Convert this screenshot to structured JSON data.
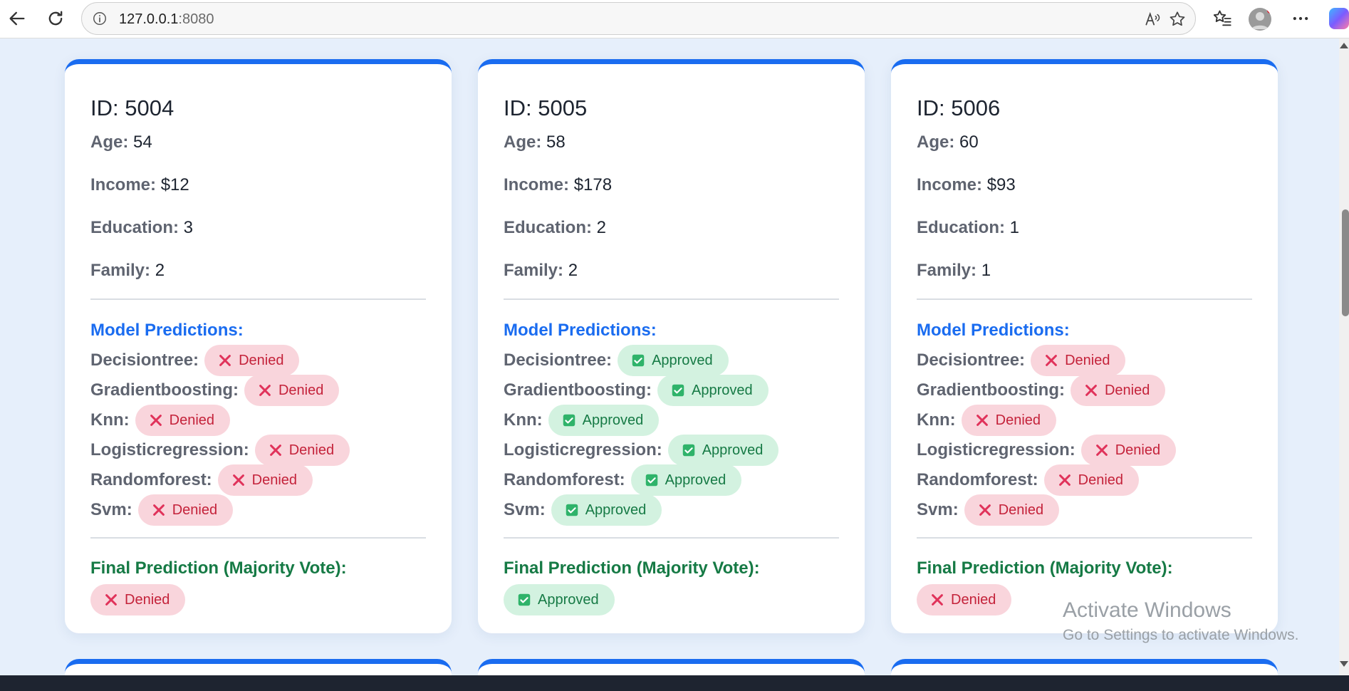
{
  "browser": {
    "url_host": "127.0.0.1",
    "url_port": ":8080"
  },
  "cards": [
    {
      "id": "ID: 5004",
      "age_label": "Age:",
      "age": "54",
      "income_label": "Income:",
      "income": "$12",
      "education_label": "Education:",
      "education": "3",
      "family_label": "Family:",
      "family": "2",
      "predictions_title": "Model Predictions:",
      "predictions": [
        {
          "model": "Decisiontree:",
          "result": "Denied",
          "status": "denied"
        },
        {
          "model": "Gradientboosting:",
          "result": "Denied",
          "status": "denied"
        },
        {
          "model": "Knn:",
          "result": "Denied",
          "status": "denied"
        },
        {
          "model": "Logisticregression:",
          "result": "Denied",
          "status": "denied"
        },
        {
          "model": "Randomforest:",
          "result": "Denied",
          "status": "denied"
        },
        {
          "model": "Svm:",
          "result": "Denied",
          "status": "denied"
        }
      ],
      "final_title": "Final Prediction (Majority Vote):",
      "final": "Denied",
      "final_status": "denied"
    },
    {
      "id": "ID: 5005",
      "age_label": "Age:",
      "age": "58",
      "income_label": "Income:",
      "income": "$178",
      "education_label": "Education:",
      "education": "2",
      "family_label": "Family:",
      "family": "2",
      "predictions_title": "Model Predictions:",
      "predictions": [
        {
          "model": "Decisiontree:",
          "result": "Approved",
          "status": "approved"
        },
        {
          "model": "Gradientboosting:",
          "result": "Approved",
          "status": "approved"
        },
        {
          "model": "Knn:",
          "result": "Approved",
          "status": "approved"
        },
        {
          "model": "Logisticregression:",
          "result": "Approved",
          "status": "approved"
        },
        {
          "model": "Randomforest:",
          "result": "Approved",
          "status": "approved"
        },
        {
          "model": "Svm:",
          "result": "Approved",
          "status": "approved"
        }
      ],
      "final_title": "Final Prediction (Majority Vote):",
      "final": "Approved",
      "final_status": "approved"
    },
    {
      "id": "ID: 5006",
      "age_label": "Age:",
      "age": "60",
      "income_label": "Income:",
      "income": "$93",
      "education_label": "Education:",
      "education": "1",
      "family_label": "Family:",
      "family": "1",
      "predictions_title": "Model Predictions:",
      "predictions": [
        {
          "model": "Decisiontree:",
          "result": "Denied",
          "status": "denied"
        },
        {
          "model": "Gradientboosting:",
          "result": "Denied",
          "status": "denied"
        },
        {
          "model": "Knn:",
          "result": "Denied",
          "status": "denied"
        },
        {
          "model": "Logisticregression:",
          "result": "Denied",
          "status": "denied"
        },
        {
          "model": "Randomforest:",
          "result": "Denied",
          "status": "denied"
        },
        {
          "model": "Svm:",
          "result": "Denied",
          "status": "denied"
        }
      ],
      "final_title": "Final Prediction (Majority Vote):",
      "final": "Denied",
      "final_status": "denied"
    }
  ],
  "watermark": {
    "line1": "Activate Windows",
    "line2": "Go to Settings to activate Windows."
  },
  "colors": {
    "accent": "#1a6cf0",
    "denied_bg": "#f9d5dc",
    "denied_text": "#c4223a",
    "approved_bg": "#d3f2e0",
    "approved_text": "#167a45"
  }
}
